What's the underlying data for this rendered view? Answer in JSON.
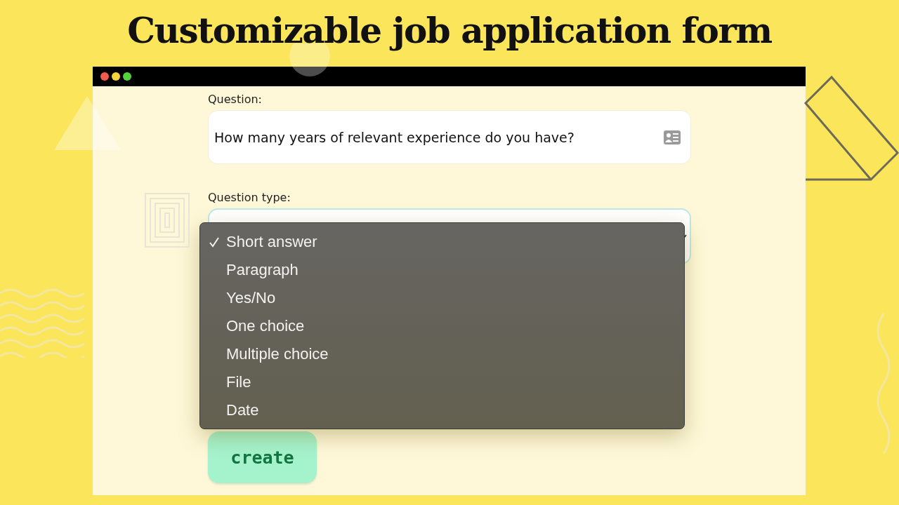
{
  "headline": "Customizable job application form",
  "window": {
    "controls": [
      {
        "color": "#f25c4c"
      },
      {
        "color": "#f5d33a"
      },
      {
        "color": "#55d13e"
      }
    ]
  },
  "question": {
    "label": "Question:",
    "value": "How many years of relevant experience do you have?"
  },
  "question_type": {
    "label": "Question type:",
    "options": [
      {
        "label": "Short answer",
        "selected": true
      },
      {
        "label": "Paragraph",
        "selected": false
      },
      {
        "label": "Yes/No",
        "selected": false
      },
      {
        "label": "One choice",
        "selected": false
      },
      {
        "label": "Multiple choice",
        "selected": false
      },
      {
        "label": "File",
        "selected": false
      },
      {
        "label": "Date",
        "selected": false
      }
    ]
  },
  "create_button": "create"
}
